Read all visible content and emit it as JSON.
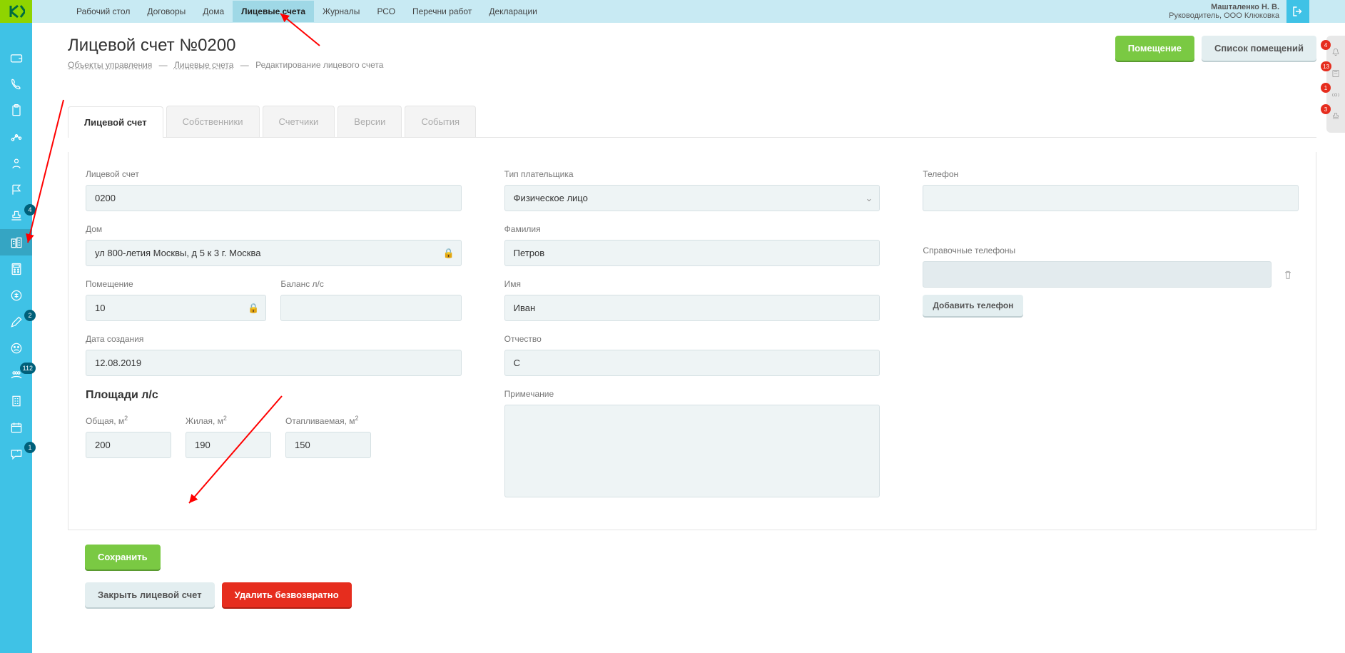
{
  "topnav": [
    "Рабочий стол",
    "Договоры",
    "Дома",
    "Лицевые счета",
    "Журналы",
    "РСО",
    "Перечни работ",
    "Декларации"
  ],
  "topnav_active": 3,
  "user": {
    "name": "Машталенко Н. В.",
    "role": "Руководитель, ООО Клюковка"
  },
  "page_title": "Лицевой счет №0200",
  "breadcrumb": {
    "a": "Объекты управления",
    "b": "Лицевые счета",
    "c": "Редактирование лицевого счета"
  },
  "header_buttons": {
    "room": "Помещение",
    "room_list": "Список помещений"
  },
  "tabs": [
    "Лицевой счет",
    "Собственники",
    "Счетчики",
    "Версии",
    "События"
  ],
  "tabs_active": 0,
  "form": {
    "labels": {
      "account": "Лицевой счет",
      "house": "Дом",
      "room": "Помещение",
      "balance": "Баланс л/с",
      "created": "Дата создания",
      "areas": "Площади л/с",
      "area_total": "Общая, м",
      "area_live": "Жилая, м",
      "area_heat": "Отапливаемая, м",
      "payer_type": "Тип плательщика",
      "lastname": "Фамилия",
      "firstname": "Имя",
      "patronymic": "Отчество",
      "note": "Примечание",
      "phone": "Телефон",
      "ref_phones": "Справочные телефоны",
      "add_phone": "Добавить телефон"
    },
    "values": {
      "account": "0200",
      "house": "ул 800-летия Москвы, д 5 к 3 г. Москва",
      "room": "10",
      "balance": "",
      "created": "12.08.2019",
      "area_total": "200",
      "area_live": "190",
      "area_heat": "150",
      "payer_type": "Физическое лицо",
      "lastname": "Петров",
      "firstname": "Иван",
      "patronymic": "С",
      "note": "",
      "phone": "",
      "ref_phone": ""
    }
  },
  "actions": {
    "save": "Сохранить",
    "close": "Закрыть лицевой счет",
    "delete": "Удалить безвозвратно"
  },
  "side_badges": {
    "i6": "4",
    "i10": "2",
    "i12": "112",
    "i15": "1"
  },
  "right_badges": [
    "4",
    "13",
    "1",
    "3"
  ]
}
